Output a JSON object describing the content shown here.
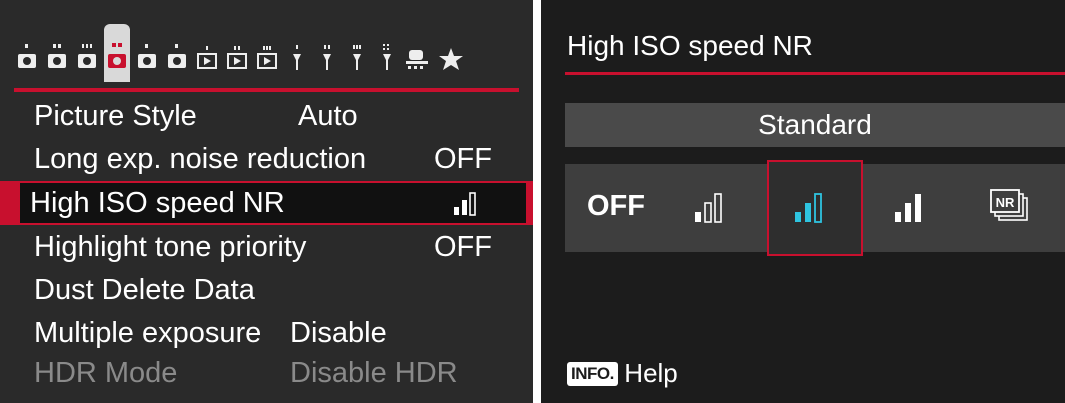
{
  "left_menu": {
    "tabs": [
      {
        "icon": "camera-shooting-icon",
        "number": "1"
      },
      {
        "icon": "camera-shooting-icon",
        "number": "2"
      },
      {
        "icon": "camera-shooting-icon",
        "number": "3"
      },
      {
        "icon": "camera-shooting-icon",
        "number": "4",
        "active": true
      },
      {
        "icon": "camera-shooting-icon",
        "number": "5"
      },
      {
        "icon": "camera-shooting-icon",
        "number": "6"
      },
      {
        "icon": "playback-icon",
        "number": "1"
      },
      {
        "icon": "playback-icon",
        "number": "2"
      },
      {
        "icon": "playback-icon",
        "number": "3"
      },
      {
        "icon": "setup-wrench-icon",
        "number": "1"
      },
      {
        "icon": "setup-wrench-icon",
        "number": "2"
      },
      {
        "icon": "setup-wrench-icon",
        "number": "3"
      },
      {
        "icon": "setup-wrench-icon",
        "number": "4"
      },
      {
        "icon": "custom-functions-icon",
        "number": ""
      },
      {
        "icon": "my-menu-star-icon",
        "number": ""
      }
    ],
    "items": [
      {
        "label": "Picture Style",
        "value": "Auto"
      },
      {
        "label": "Long exp. noise reduction",
        "value": "OFF"
      },
      {
        "label": "High ISO speed NR",
        "value": "",
        "value_icon": "nr-standard-icon",
        "selected": true
      },
      {
        "label": "Highlight tone priority",
        "value": "OFF"
      },
      {
        "label": "Dust Delete Data",
        "value": ""
      },
      {
        "label": "Multiple exposure",
        "value": "Disable"
      },
      {
        "label": "HDR Mode",
        "value": "Disable HDR",
        "disabled": true
      }
    ]
  },
  "right_screen": {
    "title": "High ISO speed NR",
    "current_setting": "Standard",
    "options": [
      {
        "label": "OFF",
        "icon": ""
      },
      {
        "label": "",
        "icon": "nr-low-icon"
      },
      {
        "label": "",
        "icon": "nr-standard-icon",
        "selected": true
      },
      {
        "label": "",
        "icon": "nr-high-icon"
      },
      {
        "label": "",
        "icon": "nr-multishot-icon"
      }
    ],
    "help_badge": "INFO.",
    "help_label": "Help"
  },
  "colors": {
    "accent": "#c8102e",
    "highlight": "#2ec4e0",
    "background": "#2a2a2a"
  }
}
